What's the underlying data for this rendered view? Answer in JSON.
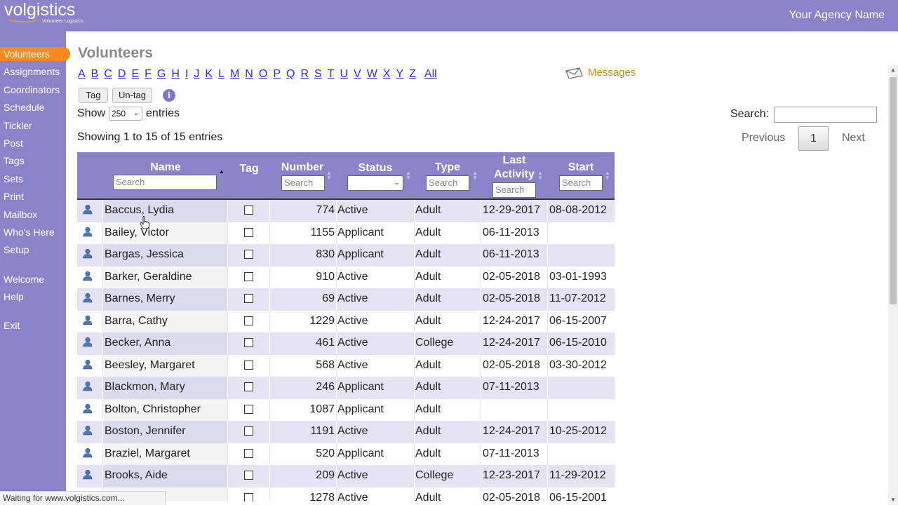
{
  "header": {
    "logo": "volgistics",
    "logo_sub": "Volunteer Logistics",
    "agency": "Your Agency Name"
  },
  "sidebar": {
    "items": [
      {
        "label": "Volunteers",
        "active": true
      },
      {
        "label": "Assignments"
      },
      {
        "label": "Coordinators"
      },
      {
        "label": "Schedule"
      },
      {
        "label": "Tickler"
      },
      {
        "label": "Post"
      },
      {
        "label": "Tags"
      },
      {
        "label": "Sets"
      },
      {
        "label": "Print"
      },
      {
        "label": "Mailbox"
      },
      {
        "label": "Who's Here"
      },
      {
        "label": "Setup"
      },
      {
        "label": "Welcome"
      },
      {
        "label": "Help"
      },
      {
        "label": "Exit"
      }
    ]
  },
  "main": {
    "title": "Volunteers",
    "letters": [
      "A",
      "B",
      "C",
      "D",
      "E",
      "F",
      "G",
      "H",
      "I",
      "J",
      "K",
      "L",
      "M",
      "N",
      "O",
      "P",
      "Q",
      "R",
      "S",
      "T",
      "U",
      "V",
      "W",
      "X",
      "Y",
      "Z"
    ],
    "all_label": "All",
    "messages_label": "Messages",
    "tag_button": "Tag",
    "untag_button": "Un-tag",
    "info_glyph": "i",
    "show_label": "Show",
    "entries_value": "250",
    "entries_label": "entries",
    "info_text": "Showing 1 to 15 of 15 entries",
    "search_label": "Search:",
    "search_value": "",
    "pager": {
      "previous": "Previous",
      "page": "1",
      "next": "Next"
    }
  },
  "table": {
    "columns": {
      "name": "Name",
      "tag": "Tag",
      "number": "Number",
      "status": "Status",
      "type": "Type",
      "last_activity_1": "Last",
      "last_activity_2": "Activity",
      "start": "Start"
    },
    "search_placeholder": "Search",
    "rows": [
      {
        "name": "Baccus, Lydia",
        "number": "774",
        "status": "Active",
        "type": "Adult",
        "last": "12-29-2017",
        "start": "08-08-2012"
      },
      {
        "name": "Bailey, Victor",
        "number": "1155",
        "status": "Applicant",
        "type": "Adult",
        "last": "06-11-2013",
        "start": ""
      },
      {
        "name": "Bargas, Jessica",
        "number": "830",
        "status": "Applicant",
        "type": "Adult",
        "last": "06-11-2013",
        "start": ""
      },
      {
        "name": "Barker, Geraldine",
        "number": "910",
        "status": "Active",
        "type": "Adult",
        "last": "02-05-2018",
        "start": "03-01-1993"
      },
      {
        "name": "Barnes, Merry",
        "number": "69",
        "status": "Active",
        "type": "Adult",
        "last": "02-05-2018",
        "start": "11-07-2012"
      },
      {
        "name": "Barra, Cathy",
        "number": "1229",
        "status": "Active",
        "type": "Adult",
        "last": "12-24-2017",
        "start": "06-15-2007"
      },
      {
        "name": "Becker, Anna",
        "number": "461",
        "status": "Active",
        "type": "College",
        "last": "12-24-2017",
        "start": "06-15-2010"
      },
      {
        "name": "Beesley, Margaret",
        "number": "568",
        "status": "Active",
        "type": "Adult",
        "last": "02-05-2018",
        "start": "03-30-2012"
      },
      {
        "name": "Blackmon, Mary",
        "number": "246",
        "status": "Applicant",
        "type": "Adult",
        "last": "07-11-2013",
        "start": ""
      },
      {
        "name": "Bolton, Christopher",
        "number": "1087",
        "status": "Applicant",
        "type": "Adult",
        "last": "",
        "start": ""
      },
      {
        "name": "Boston, Jennifer",
        "number": "1191",
        "status": "Active",
        "type": "Adult",
        "last": "12-24-2017",
        "start": "10-25-2012"
      },
      {
        "name": "Braziel, Margaret",
        "number": "520",
        "status": "Applicant",
        "type": "Adult",
        "last": "07-11-2013",
        "start": ""
      },
      {
        "name": "Brooks, Aide",
        "number": "209",
        "status": "Active",
        "type": "College",
        "last": "12-23-2017",
        "start": "11-29-2012"
      },
      {
        "name": "",
        "number": "1278",
        "status": "Active",
        "type": "Adult",
        "last": "02-05-2018",
        "start": "06-15-2001"
      }
    ]
  },
  "status_bar": "Waiting for www.volgistics.com...",
  "colors": {
    "header": "#8b83c9",
    "active": "#f58a1f",
    "link": "#2d2ec8",
    "messages": "#c98a2a"
  },
  "icons": {
    "messages": "envelope-icon",
    "info": "info-icon",
    "volunteer": "person-icon"
  }
}
